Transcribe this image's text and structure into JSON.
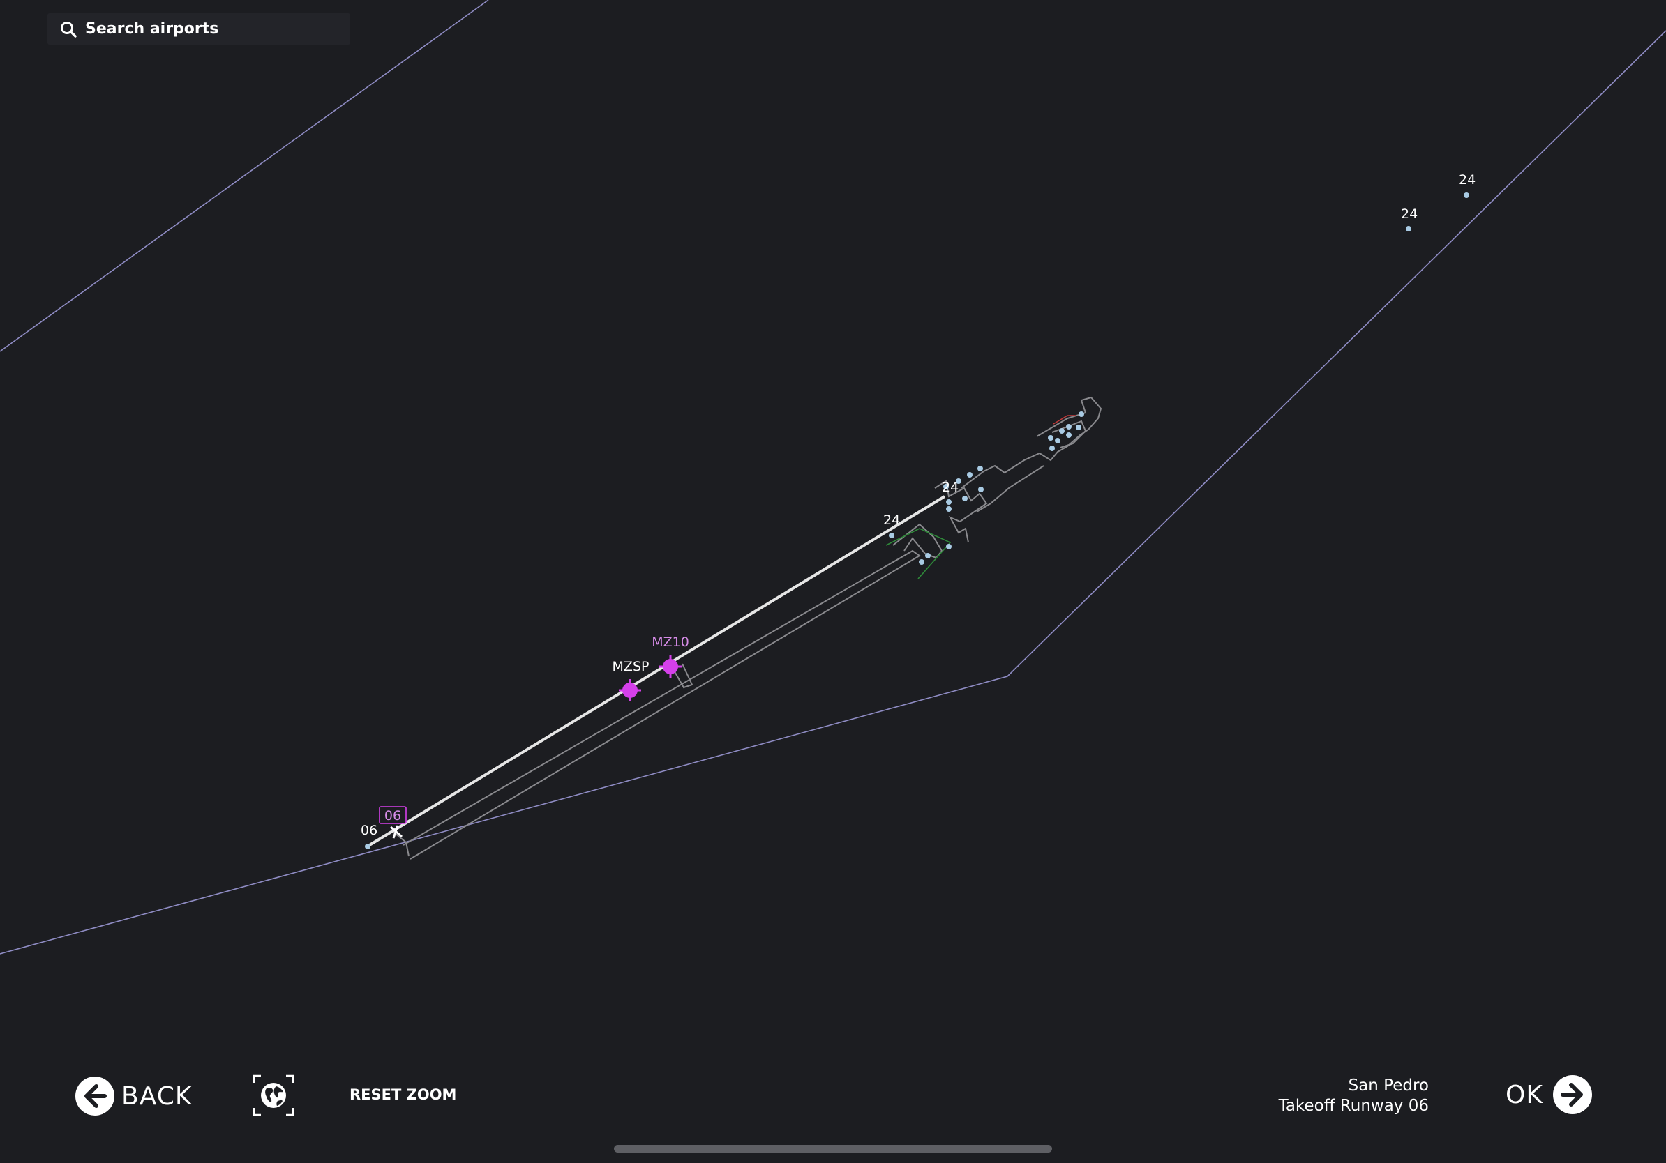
{
  "search": {
    "placeholder": "Search airports",
    "icon": "search-icon"
  },
  "map": {
    "waypoints": [
      {
        "id": "MZSP",
        "label": "MZSP",
        "color": "#d540ea"
      },
      {
        "id": "MZ10",
        "label": "MZ10",
        "color": "#d540ea"
      }
    ],
    "runway_label_selected": "06",
    "runway_labels": {
      "rw06": "06",
      "rw24_main": "24",
      "rw24_taxi": "24",
      "rw24_far1": "24",
      "rw24_far2": "24"
    },
    "colors": {
      "background": "#1c1d21",
      "boundary": "#8f8cc4",
      "runway": "#e6e6e6",
      "taxiway": "#8a8a8e",
      "waypoint": "#d540ea",
      "node": "#a9cbe4"
    }
  },
  "controls": {
    "back_label": "BACK",
    "back_icon": "arrow-left-icon",
    "globe_icon": "globe-icon",
    "reset_zoom_label": "RESET ZOOM",
    "ok_label": "OK",
    "ok_icon": "arrow-right-icon"
  },
  "info": {
    "airport": "San Pedro",
    "procedure": "Takeoff Runway 06"
  }
}
